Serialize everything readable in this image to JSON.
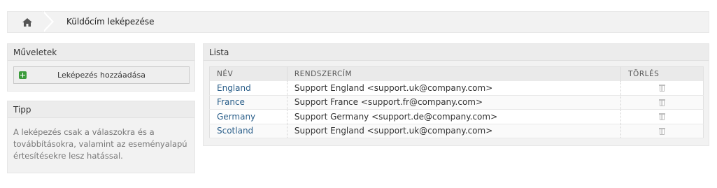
{
  "breadcrumb": {
    "home_icon": "home-icon",
    "title": "Küldőcím leképezése"
  },
  "actions": {
    "header": "Műveletek",
    "add_button": "Leképezés hozzáadása",
    "add_icon": "plus-icon",
    "add_icon_color": "#3a9b3a"
  },
  "tip": {
    "header": "Tipp",
    "text": "A leképezés csak a válaszokra és a továbbításokra, valamint az eseményalapú értesítésekre lesz hatással."
  },
  "list": {
    "header": "Lista",
    "columns": [
      "NÉV",
      "RENDSZERCÍM",
      "TÖRLÉS"
    ],
    "rows": [
      {
        "name": "England",
        "address": "Support England <support.uk@company.com>"
      },
      {
        "name": "France",
        "address": "Support France <support.fr@company.com>"
      },
      {
        "name": "Germany",
        "address": "Support Germany <support.de@company.com>"
      },
      {
        "name": "Scotland",
        "address": "Support England <support.uk@company.com>"
      }
    ],
    "link_color": "#2b5f8a"
  }
}
